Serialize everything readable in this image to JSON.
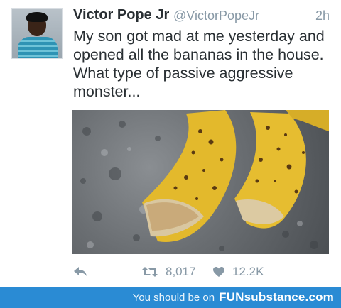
{
  "tweet": {
    "author_name": "Victor Pope Jr",
    "handle": "@VictorPopeJr",
    "time": "2h",
    "text": "My son got mad at me yesterday and opened all the bananas in the house. What type of passive aggressive monster...",
    "retweet_count": "8,017",
    "like_count": "12.2K"
  },
  "icons": {
    "reply": "reply-icon",
    "retweet": "retweet-icon",
    "like": "heart-icon"
  },
  "footer": {
    "prefix": "You should be on",
    "brand": "FUNsubstance.com"
  },
  "colors": {
    "text": "#292f33",
    "muted": "#8899a6",
    "footer_bg": "#2a8bd4"
  }
}
